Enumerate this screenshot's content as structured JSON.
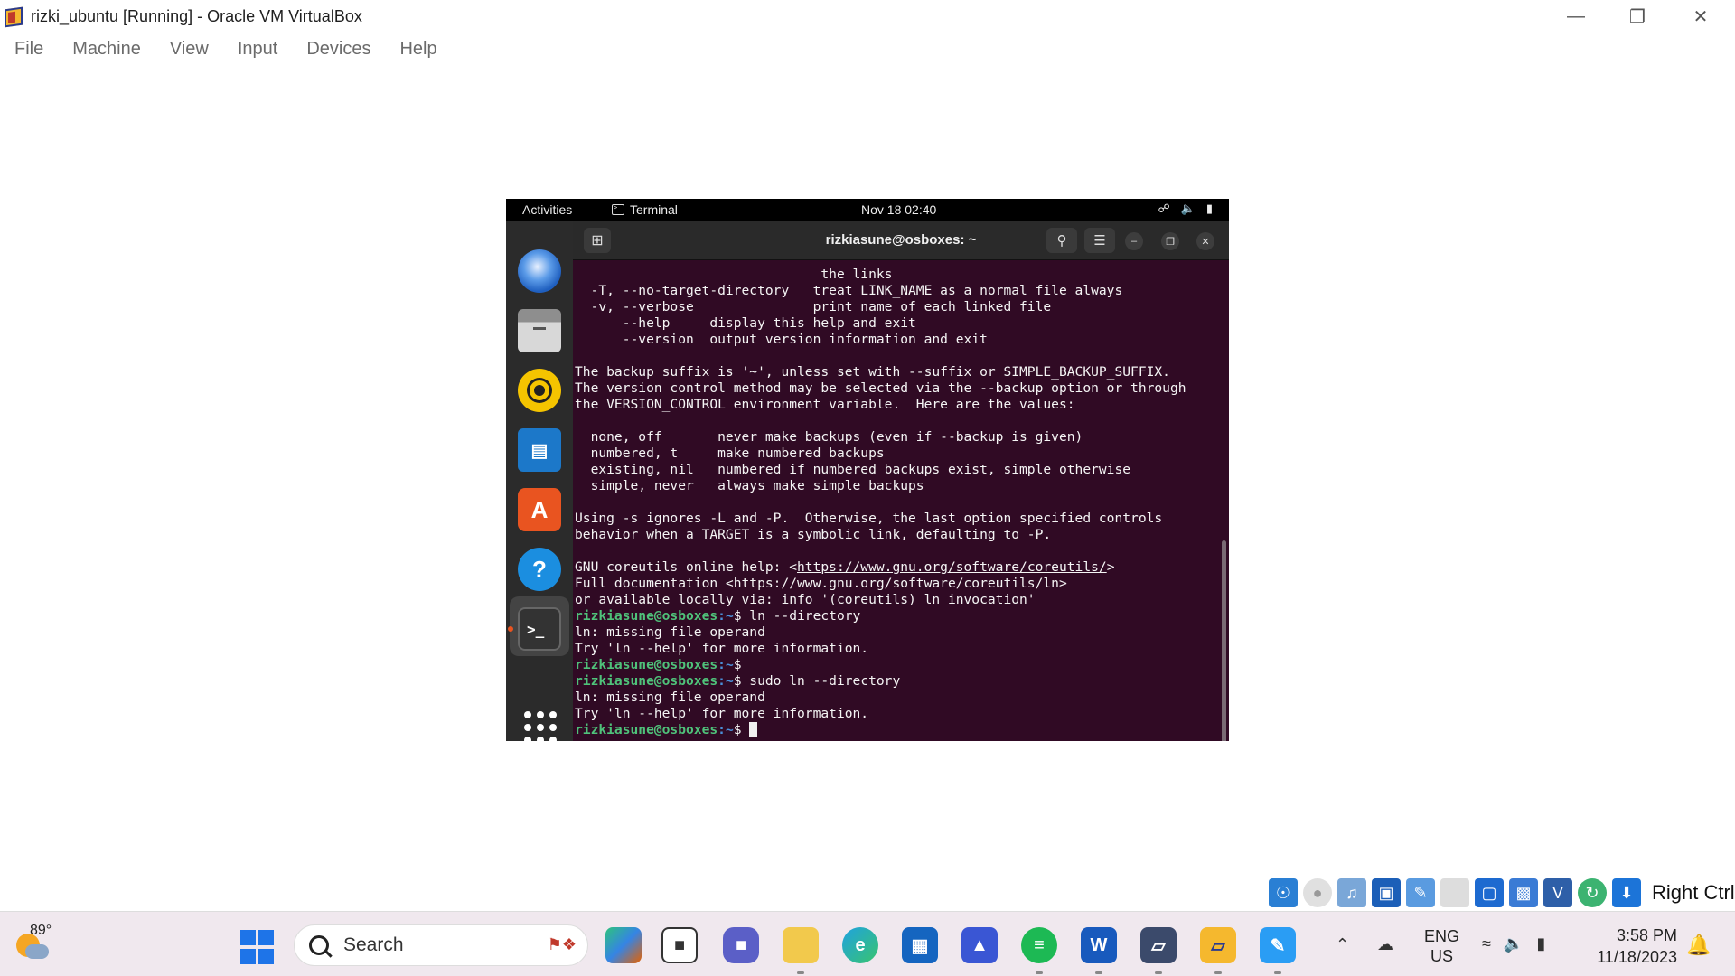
{
  "window": {
    "title": "rizki_ubuntu [Running] - Oracle VM VirtualBox"
  },
  "menubar": [
    "File",
    "Machine",
    "View",
    "Input",
    "Devices",
    "Help"
  ],
  "guest": {
    "topbar": {
      "activities": "Activities",
      "app": "Terminal",
      "clock": "Nov 18  02:40"
    },
    "terminal": {
      "title": "rizkiasune@osboxes: ~",
      "prompt_user": "rizkiasune@osboxes",
      "prompt_path": ":~",
      "lines": [
        {
          "text": "                               the links"
        },
        {
          "text": "  -T, --no-target-directory   treat LINK_NAME as a normal file always"
        },
        {
          "text": "  -v, --verbose               print name of each linked file"
        },
        {
          "text": "      --help     display this help and exit"
        },
        {
          "text": "      --version  output version information and exit"
        },
        {
          "text": ""
        },
        {
          "text": "The backup suffix is '~', unless set with --suffix or SIMPLE_BACKUP_SUFFIX."
        },
        {
          "text": "The version control method may be selected via the --backup option or through"
        },
        {
          "text": "the VERSION_CONTROL environment variable.  Here are the values:"
        },
        {
          "text": ""
        },
        {
          "text": "  none, off       never make backups (even if --backup is given)"
        },
        {
          "text": "  numbered, t     make numbered backups"
        },
        {
          "text": "  existing, nil   numbered if numbered backups exist, simple otherwise"
        },
        {
          "text": "  simple, never   always make simple backups"
        },
        {
          "text": ""
        },
        {
          "text": "Using -s ignores -L and -P.  Otherwise, the last option specified controls"
        },
        {
          "text": "behavior when a TARGET is a symbolic link, defaulting to -P."
        },
        {
          "text": ""
        },
        {
          "text": "GNU coreutils online help: <",
          "link": "https://www.gnu.org/software/coreutils/",
          "after": ">"
        },
        {
          "text": "Full documentation <https://www.gnu.org/software/coreutils/ln>"
        },
        {
          "text": "or available locally via: info '(coreutils) ln invocation'"
        },
        {
          "prompt": true,
          "cmd": "$ ln --directory"
        },
        {
          "text": "ln: missing file operand"
        },
        {
          "text": "Try 'ln --help' for more information."
        },
        {
          "prompt": true,
          "cmd": "$ "
        },
        {
          "prompt": true,
          "cmd": "$ sudo ln --directory"
        },
        {
          "text": "ln: missing file operand"
        },
        {
          "text": "Try 'ln --help' for more information."
        },
        {
          "prompt": true,
          "cmd": "$ ",
          "cursor": true
        }
      ]
    }
  },
  "statusbar": {
    "host_key": "Right Ctrl"
  },
  "taskbar": {
    "weather_temp": "89°",
    "search_placeholder": "Search",
    "language": {
      "line1": "ENG",
      "line2": "US"
    },
    "time": "3:58 PM",
    "date": "11/18/2023"
  }
}
